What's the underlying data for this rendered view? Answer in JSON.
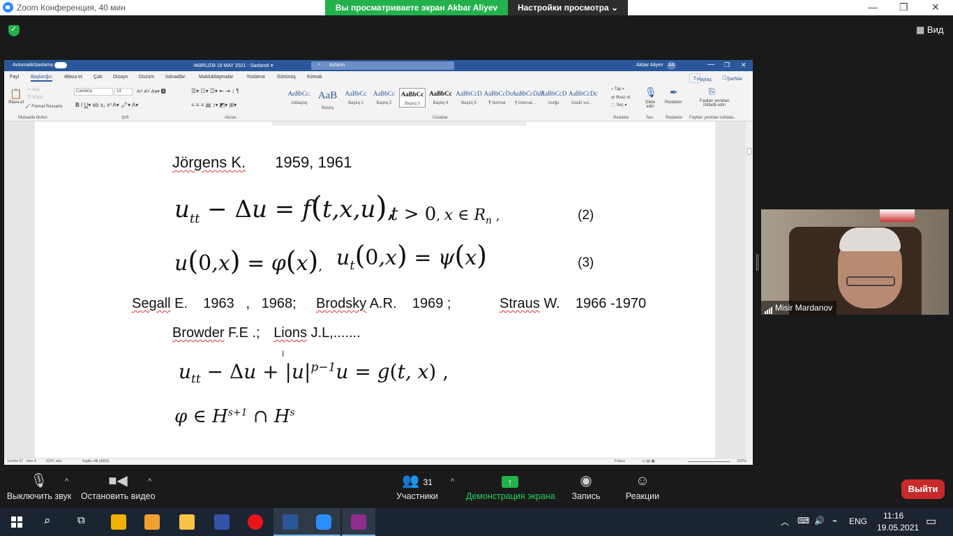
{
  "zoom": {
    "window_title": "Zoom Конференция, 40 мин",
    "share_banner": "Вы просматриваете экран Akbar Aliyev",
    "view_options": "Настройки просмотра ⌄",
    "view_button": "Вид",
    "controls": {
      "minimize": "—",
      "maximize": "❐",
      "close": "✕"
    }
  },
  "word": {
    "autosave": "AvtomatikSaxlama",
    "doc_title": "MƏRUZƏ 19 MAY 2021 - Saxlandı ▾",
    "search_placeholder": "Axtarın",
    "user": "Akbar Aliyev",
    "user_initials": "AA",
    "tabs": [
      "Fayl",
      "Başlanğıc",
      "Əlavə et",
      "Çək",
      "Dizayn",
      "Düzüm",
      "İstinadlar",
      "Məktublaşmalar",
      "Yoxlama",
      "Görünüş",
      "Kömək"
    ],
    "share": "Paylaş",
    "comments": "Şərhlər",
    "clipboard": {
      "paste": "Əlavə et",
      "cut": "Kəs",
      "copy": "Köçür",
      "format_painter": "Format Rəssamı",
      "group": "Mübadilə Buferi"
    },
    "font": {
      "name": "Cambria",
      "size": "14",
      "group": "Şrift"
    },
    "paragraph_group": "Abzas",
    "styles": [
      {
        "sample": "AaBbCc.",
        "name": "Altbaşlıq"
      },
      {
        "sample": "AaB",
        "name": "Başlıq"
      },
      {
        "sample": "AaBbCc",
        "name": "Başlıq 1"
      },
      {
        "sample": "AaBbCc",
        "name": "Başlıq 2"
      },
      {
        "sample": "AaBbCc",
        "name": "Başlıq 3"
      },
      {
        "sample": "AaBbCc",
        "name": "Başlıq 4"
      },
      {
        "sample": "AaBbCcD",
        "name": "Başlıq 5"
      },
      {
        "sample": "AaBbCcDc",
        "name": "¶ Normal"
      },
      {
        "sample": "AaBbCcDdE",
        "name": "¶ İnterval..."
      },
      {
        "sample": "AaBbCcD",
        "name": "Vurğu"
      },
      {
        "sample": "AaBbCcDc",
        "name": "Güclü vur..."
      }
    ],
    "styles_group": "Üslublar",
    "editing": {
      "find": "Tap",
      "replace": "Əvəz et",
      "select": "Seç",
      "group": "Redakte"
    },
    "dictate": "Dikte edin",
    "voice_group": "Səs",
    "editor": "Redaktor",
    "editor_group": "Redaktor",
    "reuse": "Faylları yenidən istifadə edin",
    "reuse_group": "Faylları yenidən istifadə...",
    "status": {
      "page": "Səhifə 57 - dən 4",
      "words": "6247 söz",
      "language": "İngilis dili (ABŞ)",
      "focus": "Fokus",
      "zoom": "220%"
    }
  },
  "document": {
    "line1_name": "Jörgens K.",
    "line1_years": "1959,  1961",
    "eq2_number": "(2)",
    "eq3_number": "(3)",
    "refs_line": {
      "segall": "Segall",
      "segall_rest": "E.    1963   ,   1968;",
      "brodsky": "Brodsky",
      "brodsky_rest": "A.R.    1969 ;",
      "straus": "Straus",
      "straus_rest": "W.    1966 -1970"
    },
    "refs_line2": {
      "browder": "Browder",
      "browder_rest": "F.E .;",
      "lions": "Lions",
      "lions_rest": "J.L,......."
    }
  },
  "video": {
    "participant": "Misir Mardanov"
  },
  "toolbar": {
    "mute": "Выключить звук",
    "video": "Остановить видео",
    "participants": "Участники",
    "participants_count": "31",
    "share": "Демонстрация экрана",
    "record": "Запись",
    "reactions": "Реакции",
    "leave": "Выйти"
  },
  "taskbar": {
    "lang": "ENG",
    "time": "11:16",
    "date": "19.05.2021"
  },
  "colors": {
    "zoom_green": "#23b14d",
    "word_blue": "#2b579a",
    "leave_red": "#c72a2a"
  }
}
